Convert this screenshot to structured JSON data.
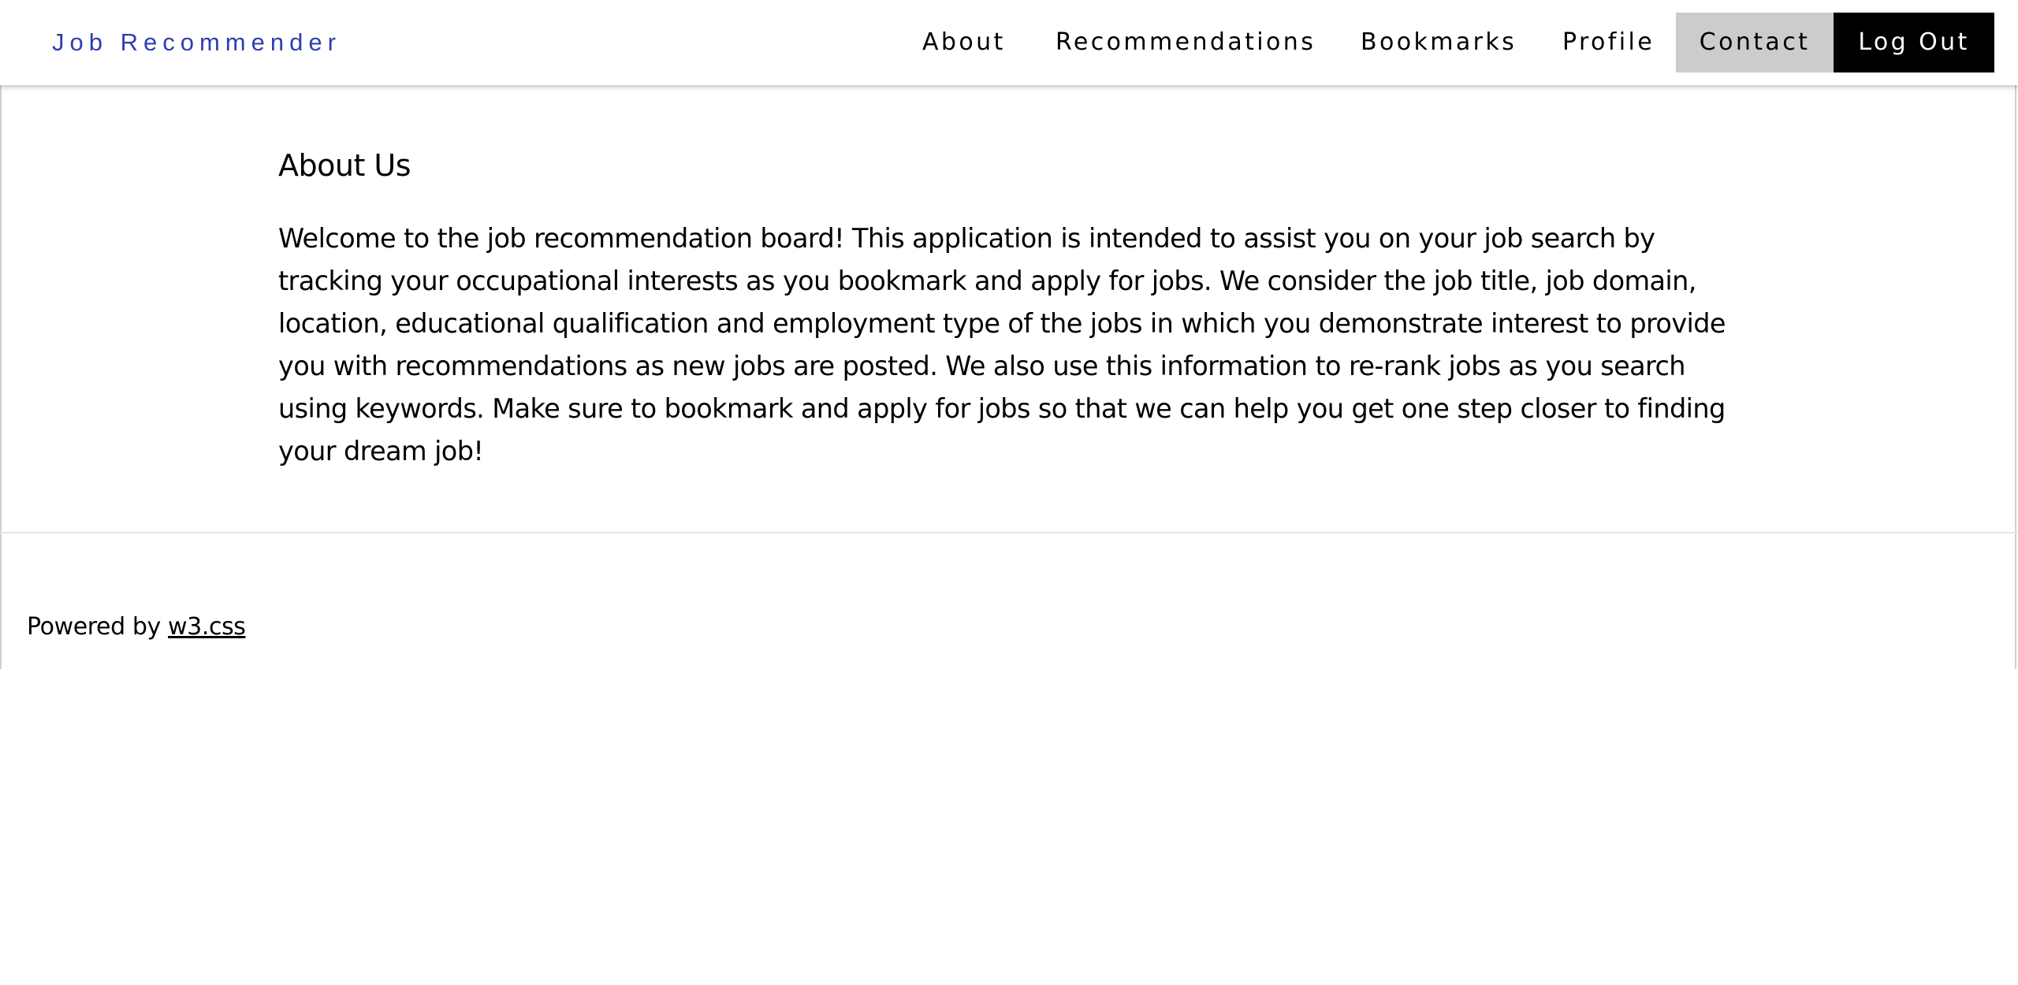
{
  "nav": {
    "brand": "Job Recommender",
    "items": [
      {
        "label": "About"
      },
      {
        "label": "Recommendations"
      },
      {
        "label": "Bookmarks"
      },
      {
        "label": "Profile"
      },
      {
        "label": "Contact"
      },
      {
        "label": "Log Out"
      }
    ],
    "colors": {
      "brand": "#2e3fb0",
      "contact_bg": "#cccccc",
      "logout_bg": "#000000",
      "logout_text": "#ffffff"
    }
  },
  "about": {
    "heading": "About Us",
    "body": "Welcome to the job recommendation board! This application is intended to assist you on your job search by tracking your occupational interests as you bookmark and apply for jobs. We consider the job title, job domain, location, educational qualification and employment type of the jobs in which you demonstrate interest to provide you with recommendations as new jobs are posted. We also use this information to re-rank jobs as you search using keywords. Make sure to bookmark and apply for jobs so that we can help you get one step closer to finding your dream job!"
  },
  "footer": {
    "prefix": "Powered by ",
    "link_text": "w3.css"
  }
}
